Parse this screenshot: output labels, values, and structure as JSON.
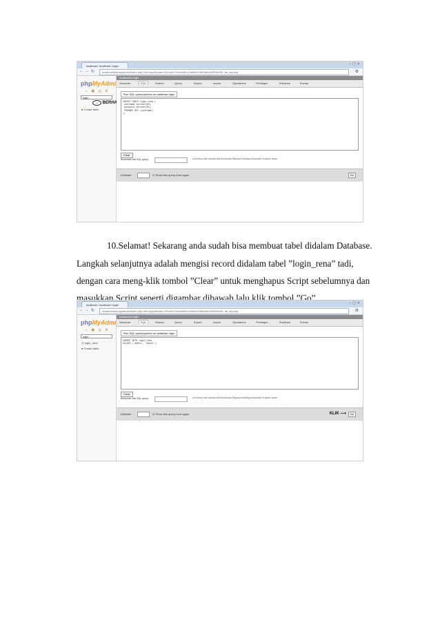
{
  "screenshot1": {
    "tab_title": "localhost / localhost / login",
    "url": "localhost/phpmyadmin/index.php?db=login&token=9f11a0c7b3d4e8f1c2a5b6d7e8f9a0b1#PMAURL:db_sql.php",
    "logo_php": "php",
    "logo_my": "My",
    "logo_admin": "Admin",
    "db_selected": "login",
    "annotation": "BERHASIL",
    "sidebar_items": [
      "Create table"
    ],
    "breadcrumb": "localhost ▸ login",
    "menu": [
      "Structure",
      "SQL",
      "Search",
      "Query",
      "Export",
      "Import",
      "Operations",
      "Privileges",
      "Routines",
      "Events"
    ],
    "legend": "Run SQL query/queries on database login",
    "sql": "CREATE TABLE login_rena (\n username varchar(30),\n password varchar(30),\n PRIMARY KEY (username)\n);",
    "clear": "Clear",
    "bookmark_label": "Bookmark this SQL query:",
    "options": "Let every user access this bookmark   Replace existing bookmark of same name",
    "delimiter_label": "Delimiter",
    "delimiter_value": ";",
    "show_query": "Show this query here again",
    "go": "Go"
  },
  "paragraph": [
    "10.Selamat! Sekarang anda sudah bisa membuat tabel didalam Database.",
    "Langkah selanjutnya adalah mengisi record didalam tabel ”login_rena” tadi,",
    "dengan cara meng-klik tombol ”Clear” untuk menghapus Script sebelumnya dan",
    "masukkan Script seperti digambar dibawah lalu klik tombol ”Go”."
  ],
  "screenshot2": {
    "tab_title": "localhost / localhost / login",
    "url": "localhost/phpmyadmin/index.php?db=login&token=9f11a0c7b3d4e8f1c2a5b6d7e8f9a0b1#PMAURL:db_sql.php",
    "logo_php": "php",
    "logo_my": "My",
    "logo_admin": "Admin",
    "db_selected": "login",
    "sidebar_items": [
      "login_rena",
      "Create table"
    ],
    "breadcrumb": "localhost ▸ login",
    "menu": [
      "Structure",
      "SQL",
      "Search",
      "Query",
      "Export",
      "Import",
      "Operations",
      "Privileges",
      "Routines",
      "Events"
    ],
    "legend": "Run SQL query/queries on database login",
    "sql": "INSERT INTO login_rena\nVALUES ('admin', 'admin');",
    "clear": "Clear",
    "bookmark_label": "Bookmark this SQL query:",
    "options": "Let every user access this bookmark   Replace existing bookmark of same name",
    "delimiter_label": "Delimiter",
    "delimiter_value": ";",
    "show_query": "Show this query here again",
    "go": "Go",
    "annotation": "KLIK"
  },
  "colors": {
    "logo_blue": "#6c78af",
    "logo_orange": "#f29b1d",
    "top_gray": "#8a8a8a"
  },
  "icons": [
    "back-arrow-icon",
    "forward-arrow-icon",
    "reload-icon",
    "wrench-icon",
    "home-icon",
    "arrow-right-icon"
  ]
}
